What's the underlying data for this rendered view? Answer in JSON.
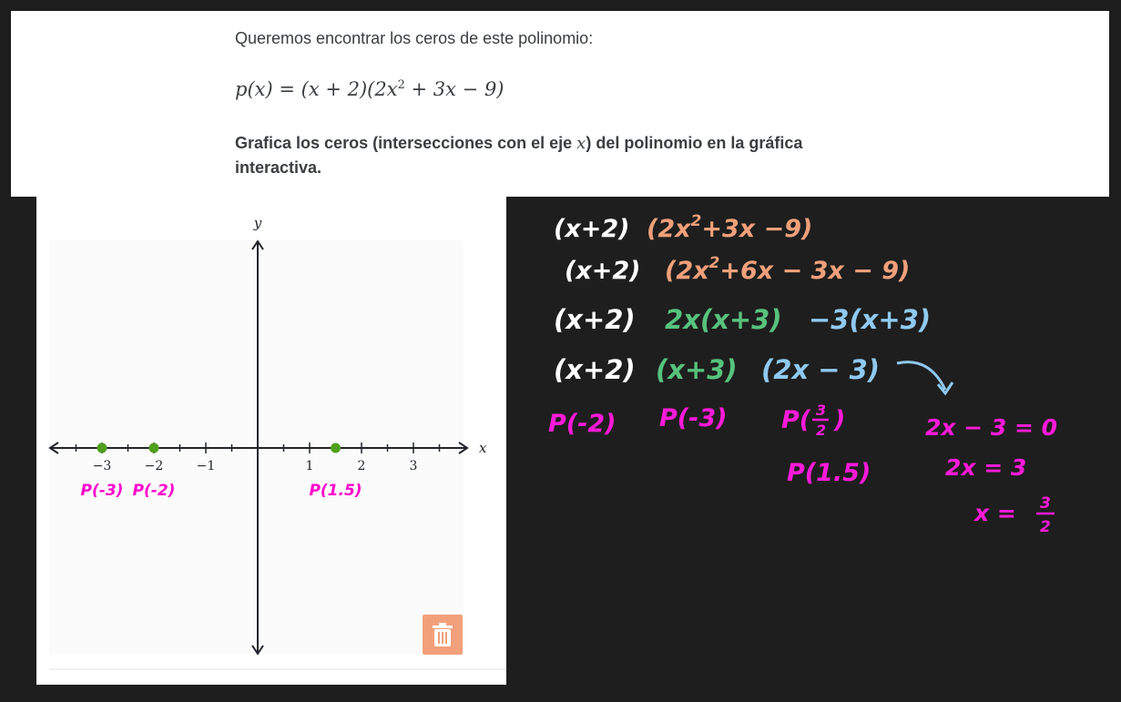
{
  "problem": {
    "prompt": "Queremos encontrar los ceros de este polinomio:",
    "polynomial": {
      "lhs": "p(x) = ",
      "body": "(x + 2)(2x",
      "exp": "2",
      "tail": " + 3x − 9)"
    },
    "instruction_before": "Grafica los ceros (intersecciones con el eje ",
    "instruction_var": "x",
    "instruction_after": ") del polinomio en la gráfica interactiva."
  },
  "graph": {
    "x_axis_label": "x",
    "y_axis_label": "y",
    "x_range": [
      -4,
      4
    ],
    "y_range": [
      -4,
      4
    ],
    "tick_labels": [
      {
        "value": -3,
        "text": "−3"
      },
      {
        "value": -2,
        "text": "−2"
      },
      {
        "value": -1,
        "text": "−1"
      },
      {
        "value": 1,
        "text": "1"
      },
      {
        "value": 2,
        "text": "2"
      },
      {
        "value": 3,
        "text": "3"
      }
    ],
    "points": [
      {
        "x": -3,
        "y": 0
      },
      {
        "x": -2,
        "y": 0
      },
      {
        "x": 1.5,
        "y": 0
      }
    ],
    "point_color": "#4fa01c",
    "axis_color": "#21242c",
    "point_annotations": [
      {
        "x": -3,
        "text": "P(-3)"
      },
      {
        "x": -2,
        "text": "P(-2)"
      },
      {
        "x": 1.5,
        "text": "P(1.5)"
      }
    ],
    "annotation_color": "#ff00cc"
  },
  "trash_button": {
    "icon": "trash-icon",
    "color": "#f2a07a"
  },
  "notes": {
    "colors": {
      "white": "#ffffff",
      "orange": "#f0a07a",
      "green": "#57c27d",
      "blue": "#8fc9ef",
      "magenta": "#ff1ad9"
    },
    "line1": {
      "a": "(x+2)",
      "b": "(2x",
      "b_exp": "2",
      "c": "+3x −9)"
    },
    "line2": {
      "a": "(x+2)",
      "b": "(2x",
      "b_exp": "2",
      "c": "+6x − 3x − 9)"
    },
    "line3": {
      "a": "(x+2)",
      "b": "2x(x+3)",
      "c": "−3(x+3)"
    },
    "line4": {
      "a": "(x+2)",
      "b": "(x+3)",
      "c": "(2x − 3)"
    },
    "evals": {
      "e1": "P(-2)",
      "e2": "P(-3)",
      "e3_pre": "P(",
      "e3_num": "3",
      "e3_den": "2",
      "e3_post": ")",
      "e4": "P(1.5)"
    },
    "solve": {
      "s1": "2x − 3 = 0",
      "s2": "2x = 3",
      "s3_pre": "x =",
      "s3_num": "3",
      "s3_den": "2"
    }
  }
}
